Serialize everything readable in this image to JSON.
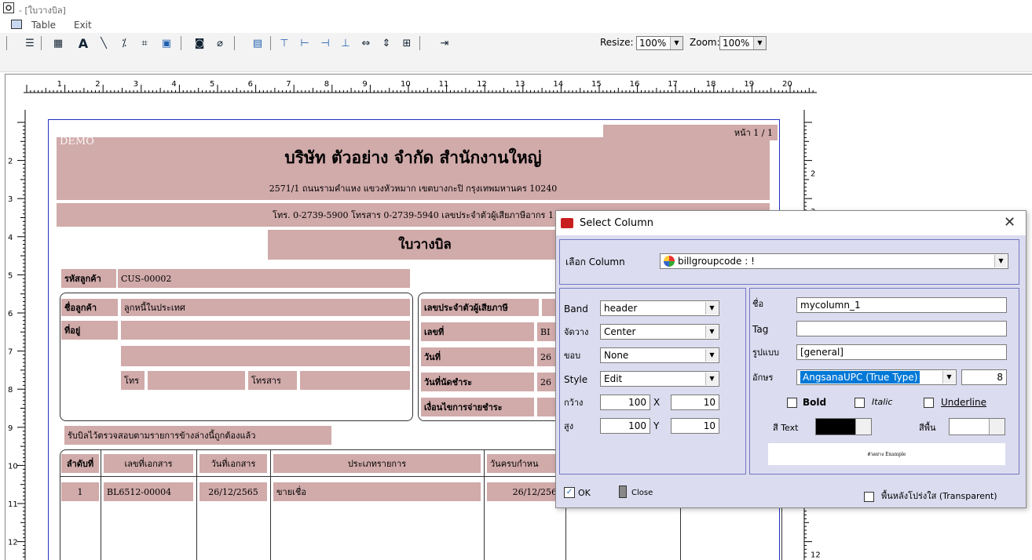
{
  "window": {
    "title": "- [ใบวางบิล]"
  },
  "menu": {
    "table": "Table",
    "exit": "Exit"
  },
  "toolbar": {
    "resize_label": "Resize:",
    "resize_value": "100%",
    "zoom_label": "Zoom:",
    "zoom_value": "100%"
  },
  "ruler": {
    "h_numbers": [
      "1",
      "2",
      "3",
      "4",
      "5",
      "6",
      "7",
      "8",
      "9",
      "10",
      "11",
      "12",
      "13",
      "14",
      "15",
      "16",
      "17",
      "18",
      "19",
      "20"
    ],
    "v_numbers": [
      "2",
      "3",
      "4",
      "5",
      "6",
      "7",
      "8",
      "9",
      "10",
      "11",
      "12"
    ],
    "r_numbers": [
      "2",
      "3",
      "12"
    ]
  },
  "report": {
    "demo": "DEMO",
    "page": "หน้า 1 / 1",
    "company": "บริษัท ตัวอย่าง จำกัด   สำนักงานใหญ่",
    "address": "2571/1 ถนนรามคำแหง แขวงหัวหมาก เขตบางกะปิ กรุงเทพมหานคร 10240",
    "phone": "โทร. 0-2739-5900  โทรสาร 0-2739-5940  เลขประจำตัวผู้เสียภาษีอากร 1",
    "doc_title": "ใบวางบิล",
    "cust_code_label": "รหัสลูกค้า",
    "cust_code": "CUS-00002",
    "cust_name_label": "ชื่อลูกค้า",
    "cust_name": "ลูกหนี้ในประเทศ",
    "address_label": "ที่อยู่",
    "tel_label": "โทร",
    "fax_label": "โทรสาร",
    "tax_id_label": "เลขประจำตัวผู้เสียภาษี",
    "doc_no_label": "เลขที่",
    "doc_no": "BI",
    "date_label": "วันที่",
    "date_val": "26",
    "appoint_label": "วันที่นัดชำระ",
    "appoint_val": "26",
    "cond_label": "เงื่อนไขการจ่ายชำระ",
    "received": "รับบิลไว้ตรวจสอบตามรายการข้างล่างนี้ถูกต้องแล้ว",
    "columns": [
      "ลำดับที่",
      "เลขที่เอกสาร",
      "วันที่เอกสาร",
      "ประเภทรายการ",
      "วันครบกำหน"
    ],
    "rows": [
      {
        "no": "1",
        "doc": "BL6512-00004",
        "date": "26/12/2565",
        "type": "ขายเชื่อ",
        "due": "26/12/2565"
      }
    ]
  },
  "dialog": {
    "title": "Select Column",
    "column_label": "เลือก Column",
    "column_value": "billgroupcode : !",
    "band_label": "Band",
    "band_value": "header",
    "align_label": "จัดวาง",
    "align_value": "Center",
    "border_label": "ขอบ",
    "border_value": "None",
    "style_label": "Style",
    "style_value": "Edit",
    "width_label": "กว้าง",
    "width_value": "100",
    "x_label": "X",
    "x_value": "10",
    "height_label": "สูง",
    "height_value": "100",
    "y_label": "Y",
    "y_value": "10",
    "name_label": "ชื่อ",
    "name_value": "mycolumn_1",
    "tag_label": "Tag",
    "tag_value": "",
    "format_label": "รูปแบบ",
    "format_value": "[general]",
    "font_label": "อักษร",
    "font_value": "AngsanaUPC (True Type)",
    "font_size": "8",
    "bold_label": "Bold",
    "italic_label": "Italic",
    "underline_label": "Underline",
    "text_color_label": "สี Text",
    "bg_color_label": "สีพื้น",
    "example": "ตัวอย่าง Example",
    "ok_label": "OK",
    "close_label": "Close",
    "transparent_label": "พื้นหลังโปร่งใส (Transparent)"
  },
  "colors": {
    "field_bg": "#d1aaaa",
    "dialog_bg": "#dcdcf0",
    "page_border": "#2030c0",
    "font_highlight": "#0078d7"
  }
}
